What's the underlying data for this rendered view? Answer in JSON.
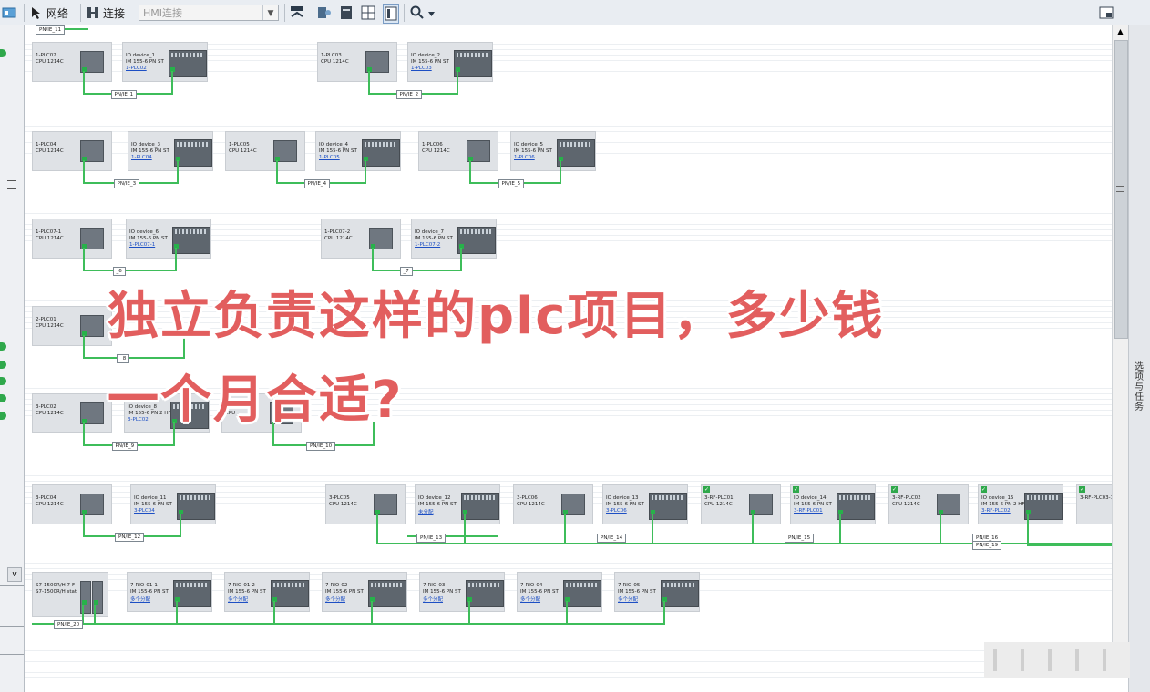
{
  "toolbar": {
    "network_label": "网络",
    "connect_label": "连接",
    "hmi_connection": "HMI连接"
  },
  "right_tab_label": "选项与任务",
  "top_net_label": "PN/IE_11",
  "rows": [
    {
      "groups": [
        {
          "plc": {
            "name": "1-PLC02",
            "type": "CPU 1214C"
          },
          "io": {
            "name": "IO device_1",
            "type": "IM 155-6 PN ST",
            "link": "1-PLC02"
          },
          "net": "PN/IE_1"
        },
        {
          "plc": {
            "name": "1-PLC03",
            "type": "CPU 1214C"
          },
          "io": {
            "name": "IO device_2",
            "type": "IM 155-6 PN ST",
            "link": "1-PLC03"
          },
          "net": "PN/IE_2"
        }
      ]
    },
    {
      "groups": [
        {
          "plc": {
            "name": "1-PLC04",
            "type": "CPU 1214C"
          },
          "io": {
            "name": "IO device_3",
            "type": "IM 155-6 PN ST",
            "link": "1-PLC04"
          },
          "net": "PN/IE_3"
        },
        {
          "plc": {
            "name": "1-PLC05",
            "type": "CPU 1214C"
          },
          "io": {
            "name": "IO device_4",
            "type": "IM 155-6 PN ST",
            "link": "1-PLC05"
          },
          "net": "PN/IE_4"
        },
        {
          "plc": {
            "name": "1-PLC06",
            "type": "CPU 1214C"
          },
          "io": {
            "name": "IO device_5",
            "type": "IM 155-6 PN ST",
            "link": "1-PLC06"
          },
          "net": "PN/IE_5"
        }
      ]
    },
    {
      "groups": [
        {
          "plc": {
            "name": "1-PLC07-1",
            "type": "CPU 1214C"
          },
          "io": {
            "name": "IO device_6",
            "type": "IM 155-6 PN ST",
            "link": "1-PLC07-1"
          },
          "net": "_6"
        },
        {
          "plc": {
            "name": "1-PLC07-2",
            "type": "CPU 1214C"
          },
          "io": {
            "name": "IO device_7",
            "type": "IM 155-6 PN ST",
            "link": "1-PLC07-2"
          },
          "net": "_7"
        }
      ]
    },
    {
      "groups": [
        {
          "plc": {
            "name": "2-PLC01",
            "type": "CPU 1214C"
          },
          "net": "_8"
        }
      ]
    },
    {
      "groups": [
        {
          "plc": {
            "name": "3-PLC02",
            "type": "CPU 1214C"
          },
          "io": {
            "name": "IO device_8",
            "type": "IM 155-6 PN 2 HF",
            "link": "3-PLC02"
          },
          "net": "PN/IE_9"
        },
        {
          "plc": {
            "name": "3-PLC",
            "type": "CPU"
          },
          "net": "PN/IE_10"
        }
      ]
    },
    {
      "groups": [
        {
          "plc": {
            "name": "3-PLC04",
            "type": "CPU 1214C"
          },
          "io": {
            "name": "IO device_11",
            "type": "IM 155-6 PN ST",
            "link": "3-PLC04"
          },
          "net": "PN/IE_12"
        }
      ]
    }
  ],
  "row6_bus": [
    {
      "plc": {
        "name": "3-PLC05",
        "type": "CPU 1214C"
      },
      "io": {
        "name": "IO device_12",
        "type": "IM 155-6 PN ST",
        "link": "未分配"
      }
    },
    {
      "plc": {
        "name": "3-PLC06",
        "type": "CPU 1214C"
      },
      "io": {
        "name": "IO device_13",
        "type": "IM 155-6 PN ST",
        "link": "3-PLC06"
      }
    },
    {
      "plc": {
        "name": "3-RF-PLC01",
        "type": "CPU 1214C"
      },
      "io": {
        "name": "IO device_14",
        "type": "IM 155-6 PN ST",
        "link": "3-RF-PLC01"
      }
    },
    {
      "plc": {
        "name": "3-RF-PLC02",
        "type": "CPU 1214C"
      },
      "io": {
        "name": "IO device_15",
        "type": "IM 155-6 PN 2 HF",
        "link": "3-RF-PLC02"
      }
    },
    {
      "plc": {
        "name": "3-RF-PLC03-1",
        "type": ""
      }
    }
  ],
  "row6_nets": [
    "PN/IE_13",
    "PN/IE_14",
    "PN/IE_15",
    "PN/IE_16",
    "PN/IE_19"
  ],
  "row7": {
    "head": {
      "name": "S7-1500R/H  7-F",
      "type": "S7-1500R/H  stat"
    },
    "ios": [
      {
        "name": "7-RIO-01-1",
        "type": "IM 155-6 PN ST",
        "link": "多个分配"
      },
      {
        "name": "7-RIO-01-2",
        "type": "IM 155-6 PN ST",
        "link": "多个分配"
      },
      {
        "name": "7-RIO-02",
        "type": "IM 155-6 PN ST",
        "link": "多个分配"
      },
      {
        "name": "7-RIO-03",
        "type": "IM 155-6 PN ST",
        "link": "多个分配"
      },
      {
        "name": "7-RIO-04",
        "type": "IM 155-6 PN ST",
        "link": "多个分配"
      },
      {
        "name": "7-RIO-05",
        "type": "IM 155-6 PN ST",
        "link": "多个分配"
      }
    ],
    "net": "PN/IE_20"
  },
  "overlay": {
    "line1": "独立负责这样的plc项目，多少钱",
    "line2": "一个月合适?"
  }
}
